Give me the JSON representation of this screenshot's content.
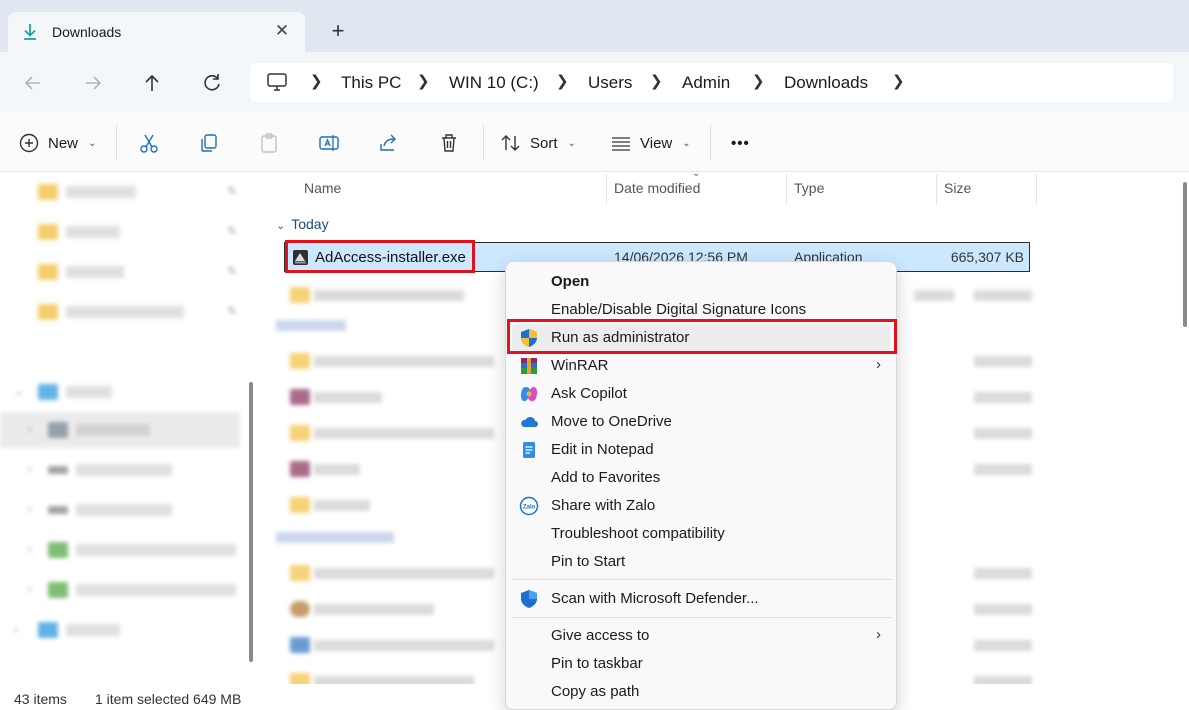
{
  "window": {
    "tab_title": "Downloads",
    "tab_close": "✕",
    "new_tab": "+"
  },
  "address": {
    "breadcrumb": [
      "This PC",
      "WIN 10 (C:)",
      "Users",
      "Admin",
      "Downloads"
    ]
  },
  "toolbar": {
    "new_label": "New",
    "sort_label": "Sort",
    "view_label": "View",
    "more_label": "•••"
  },
  "columns": {
    "name": "Name",
    "date": "Date modified",
    "type": "Type",
    "size": "Size"
  },
  "groups": {
    "today": "Today"
  },
  "selected_file": {
    "name": "AdAccess-installer.exe",
    "date": "14/06/2026 12:56 PM",
    "type": "Application",
    "size": "665,307 KB"
  },
  "context_menu": {
    "items": [
      {
        "label": "Open",
        "icon": "none"
      },
      {
        "label": "Enable/Disable Digital Signature Icons",
        "icon": "none"
      },
      {
        "label": "Run as administrator",
        "icon": "uac-shield-icon"
      },
      {
        "label": "WinRAR",
        "icon": "winrar-icon"
      },
      {
        "label": "Ask Copilot",
        "icon": "copilot-icon"
      },
      {
        "label": "Move to OneDrive",
        "icon": "onedrive-icon"
      },
      {
        "label": "Edit in Notepad",
        "icon": "notepad-icon"
      },
      {
        "label": "Add to Favorites",
        "icon": "none"
      },
      {
        "label": "Share with Zalo",
        "icon": "zalo-icon"
      },
      {
        "label": "Troubleshoot compatibility",
        "icon": "none"
      },
      {
        "label": "Pin to Start",
        "icon": "none"
      },
      {
        "label": "Scan with Microsoft Defender...",
        "icon": "defender-icon"
      },
      {
        "label": "Give access to",
        "icon": "none"
      },
      {
        "label": "Pin to taskbar",
        "icon": "none"
      },
      {
        "label": "Copy as path",
        "icon": "none"
      }
    ],
    "submenu_arrow": "›"
  },
  "status": {
    "items_count": "43 items",
    "selection": "1 item selected  649 MB"
  },
  "colors": {
    "highlight_red": "#e0121c",
    "selection_blue": "#cce8ff",
    "accent": "#0067c0"
  }
}
